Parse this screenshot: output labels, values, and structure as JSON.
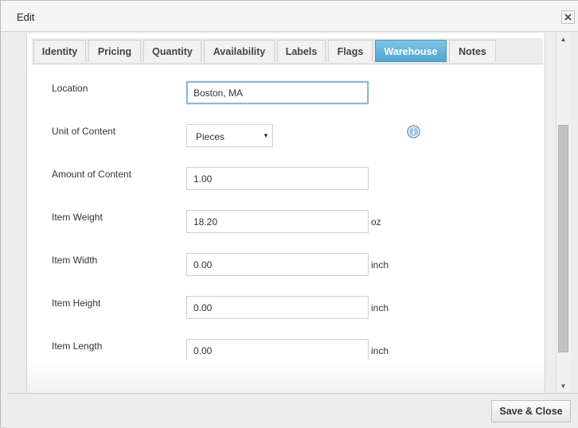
{
  "dialog": {
    "title": "Edit",
    "close_label": "×"
  },
  "tabs": [
    {
      "label": "Identity"
    },
    {
      "label": "Pricing"
    },
    {
      "label": "Quantity"
    },
    {
      "label": "Availability"
    },
    {
      "label": "Labels"
    },
    {
      "label": "Flags"
    },
    {
      "label": "Warehouse",
      "active": true
    },
    {
      "label": "Notes"
    }
  ],
  "form": {
    "location": {
      "label": "Location",
      "value": "Boston, MA"
    },
    "unit_of_content": {
      "label": "Unit of Content",
      "selected": "Pieces"
    },
    "amount_of_content": {
      "label": "Amount of Content",
      "value": "1.00"
    },
    "item_weight": {
      "label": "Item Weight",
      "value": "18.20",
      "unit": "oz"
    },
    "item_width": {
      "label": "Item Width",
      "value": "0.00",
      "unit": "inch"
    },
    "item_height": {
      "label": "Item Height",
      "value": "0.00",
      "unit": "inch"
    },
    "item_length": {
      "label": "Item Length",
      "value": "0.00",
      "unit": "inch"
    }
  },
  "footer": {
    "save_close_label": "Save & Close"
  },
  "colors": {
    "active_tab": "#5aaed6",
    "info_icon": "#6a9fc4"
  }
}
